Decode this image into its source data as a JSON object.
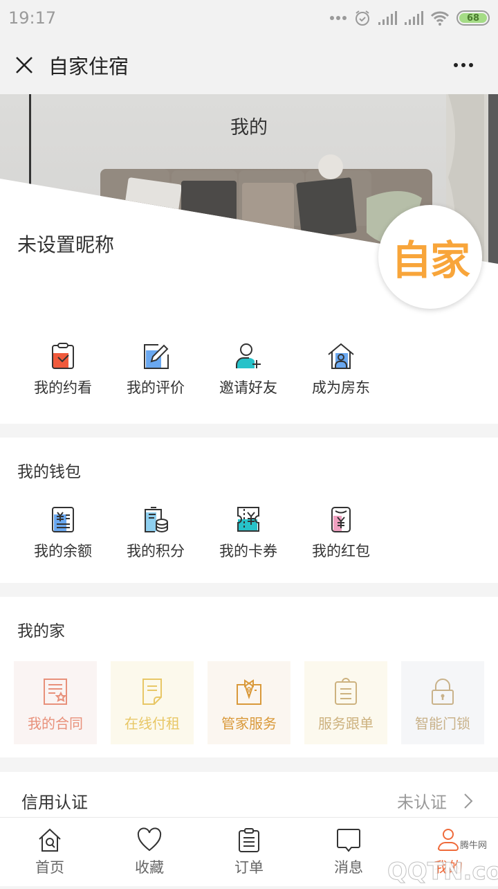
{
  "status_bar": {
    "time": "19:17",
    "battery": "68",
    "icons": [
      "more-dots-icon",
      "alarm-icon",
      "signal-icon",
      "signal-icon",
      "wifi-icon",
      "battery-icon"
    ]
  },
  "title_bar": {
    "close_icon": "close-icon",
    "title": "自家住宿",
    "more_icon": "more-icon"
  },
  "profile": {
    "page_title": "我的",
    "nickname": "未设置昵称",
    "logo_text": "自家"
  },
  "quick_actions": [
    {
      "label": "我的约看",
      "icon": "clipboard-check-icon"
    },
    {
      "label": "我的评价",
      "icon": "edit-pencil-icon"
    },
    {
      "label": "邀请好友",
      "icon": "add-user-icon"
    },
    {
      "label": "成为房东",
      "icon": "house-person-icon"
    }
  ],
  "wallet": {
    "title": "我的钱包",
    "items": [
      {
        "label": "我的余额",
        "icon": "balance-yen-icon"
      },
      {
        "label": "我的积分",
        "icon": "points-coins-icon"
      },
      {
        "label": "我的卡券",
        "icon": "coupon-ticket-icon"
      },
      {
        "label": "我的红包",
        "icon": "red-envelope-icon"
      }
    ]
  },
  "my_home": {
    "title": "我的家",
    "items": [
      {
        "label": "我的合同",
        "icon": "contract-icon",
        "color": "#e8907a",
        "bg": "#faf4f3"
      },
      {
        "label": "在线付租",
        "icon": "pay-rent-icon",
        "color": "#e8c766",
        "bg": "#fcf9ec"
      },
      {
        "label": "管家服务",
        "icon": "butler-icon",
        "color": "#d9993a",
        "bg": "#fbf6f0"
      },
      {
        "label": "服务跟单",
        "icon": "service-clipboard-icon",
        "color": "#cdb27f",
        "bg": "#fcf9ee"
      },
      {
        "label": "智能门锁",
        "icon": "smart-lock-icon",
        "color": "#c9b28a",
        "bg": "#f5f6f8"
      }
    ]
  },
  "credit": {
    "label": "信用认证",
    "status": "未认证"
  },
  "tab_bar": {
    "active_color": "#ef6a3a",
    "tabs": [
      {
        "label": "首页",
        "icon": "home-search-icon",
        "active": false
      },
      {
        "label": "收藏",
        "icon": "heart-icon",
        "active": false
      },
      {
        "label": "订单",
        "icon": "order-clipboard-icon",
        "active": false
      },
      {
        "label": "消息",
        "icon": "message-icon",
        "active": false
      },
      {
        "label": "我的",
        "icon": "user-icon",
        "active": true
      }
    ]
  },
  "watermark": {
    "text": "QQTN.com",
    "sub": "腾牛网"
  }
}
